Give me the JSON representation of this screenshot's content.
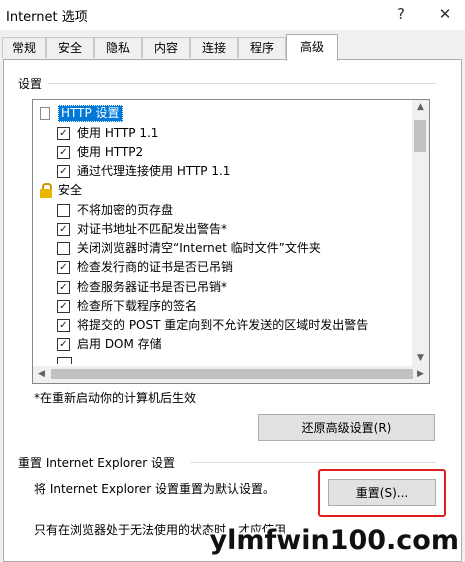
{
  "window": {
    "title": "Internet 选项",
    "help_glyph": "?",
    "close_glyph": "✕"
  },
  "tabs": [
    {
      "label": "常规",
      "active": false
    },
    {
      "label": "安全",
      "active": false
    },
    {
      "label": "隐私",
      "active": false
    },
    {
      "label": "内容",
      "active": false
    },
    {
      "label": "连接",
      "active": false
    },
    {
      "label": "程序",
      "active": false
    },
    {
      "label": "高级",
      "active": true
    }
  ],
  "settings_group": {
    "label": "设置",
    "items": [
      {
        "type": "category",
        "icon": "page-icon",
        "label": "HTTP 设置",
        "selected": true
      },
      {
        "type": "checkbox",
        "label": "使用 HTTP 1.1",
        "checked": true
      },
      {
        "type": "checkbox",
        "label": "使用 HTTP2",
        "checked": true
      },
      {
        "type": "checkbox",
        "label": "通过代理连接使用 HTTP 1.1",
        "checked": true
      },
      {
        "type": "category",
        "icon": "lock-icon",
        "label": "安全",
        "selected": false
      },
      {
        "type": "checkbox",
        "label": "不将加密的页存盘",
        "checked": false
      },
      {
        "type": "checkbox",
        "label": "对证书地址不匹配发出警告*",
        "checked": true
      },
      {
        "type": "checkbox",
        "label": "关闭浏览器时清空“Internet 临时文件”文件夹",
        "checked": false
      },
      {
        "type": "checkbox",
        "label": "检查发行商的证书是否已吊销",
        "checked": true
      },
      {
        "type": "checkbox",
        "label": "检查服务器证书是否已吊销*",
        "checked": true
      },
      {
        "type": "checkbox",
        "label": "检查所下载程序的签名",
        "checked": true
      },
      {
        "type": "checkbox",
        "label": "将提交的 POST 重定向到不允许发送的区域时发出警告",
        "checked": true
      },
      {
        "type": "checkbox",
        "label": "启用 DOM 存储",
        "checked": true
      }
    ],
    "restart_note": "*在重新启动你的计算机后生效",
    "restore_button": "还原高级设置(R)"
  },
  "reset_group": {
    "label": "重置 Internet Explorer 设置",
    "description": "将 Internet Explorer 设置重置为默认设置。",
    "reset_button": "重置(S)...",
    "note": "只有在浏览器处于无法使用的状态时，才应使用"
  },
  "watermark": "ylmfwin100.com",
  "colors": {
    "selection": "#0078d7",
    "highlight_box": "#e02020"
  }
}
